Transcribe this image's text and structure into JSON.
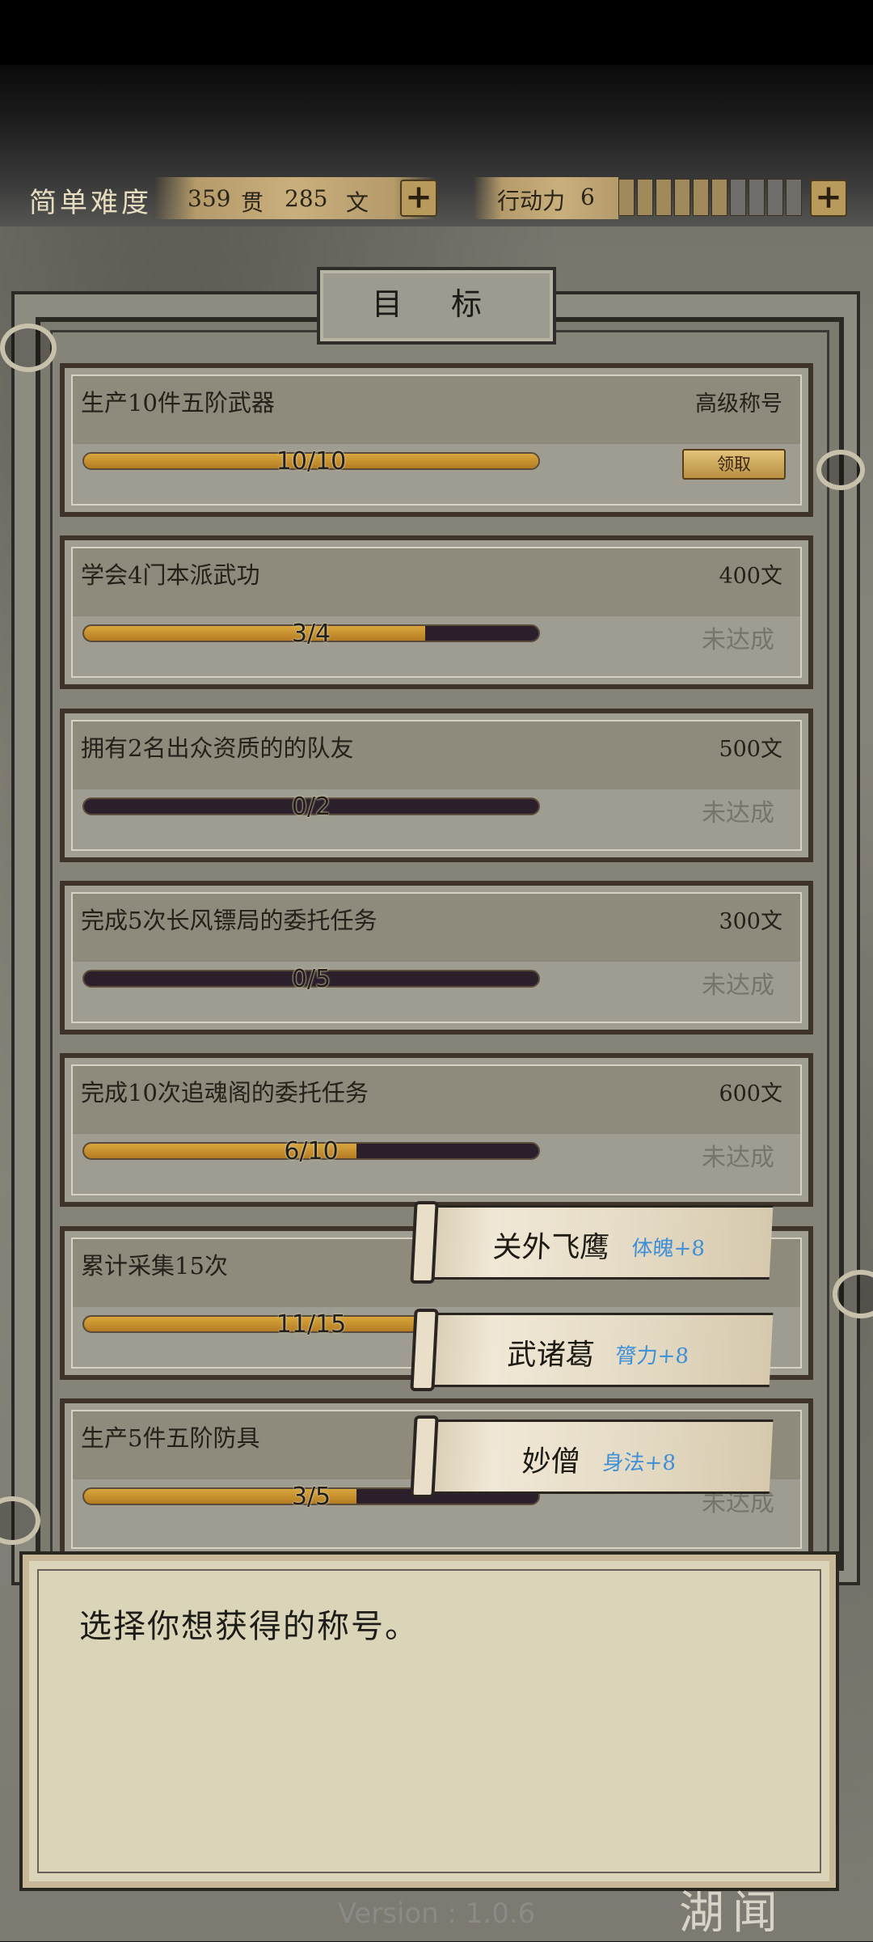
{
  "hud": {
    "difficulty": "简单难度",
    "money_guan": "359",
    "money_guan_unit": "贯",
    "money_wen": "285",
    "money_wen_unit": "文",
    "stamina_label": "行动力",
    "stamina_value": "6",
    "stamina_max": 10,
    "plus_symbol": "+"
  },
  "panel": {
    "title": "目 标"
  },
  "goals": [
    {
      "name": "生产10件五阶武器",
      "reward": "高级称号",
      "progress": "10/10",
      "fraction": 1.0,
      "status": "",
      "claim_label": "领取"
    },
    {
      "name": "学会4门本派武功",
      "reward": "400文",
      "progress": "3/4",
      "fraction": 0.75,
      "status": "未达成"
    },
    {
      "name": "拥有2名出众资质的的队友",
      "reward": "500文",
      "progress": "0/2",
      "fraction": 0.0,
      "status": "未达成"
    },
    {
      "name": "完成5次长风镖局的委托任务",
      "reward": "300文",
      "progress": "0/5",
      "fraction": 0.0,
      "status": "未达成"
    },
    {
      "name": "完成10次追魂阁的委托任务",
      "reward": "600文",
      "progress": "6/10",
      "fraction": 0.6,
      "status": "未达成"
    },
    {
      "name": "累计采集15次",
      "reward": "",
      "progress": "11/15",
      "fraction": 0.733,
      "status": ""
    },
    {
      "name": "生产5件五阶防具",
      "reward": "",
      "progress": "3/5",
      "fraction": 0.6,
      "status": "未达成"
    }
  ],
  "title_options": [
    {
      "name": "关外飞鹰",
      "bonus": "体魄+8"
    },
    {
      "name": "武诸葛",
      "bonus": "膂力+8"
    },
    {
      "name": "妙僧",
      "bonus": "身法+8"
    }
  ],
  "dialog": {
    "text": "选择你想获得的称号。"
  },
  "footer": {
    "version": "Version : 1.0.6",
    "brand": "湖闻"
  }
}
